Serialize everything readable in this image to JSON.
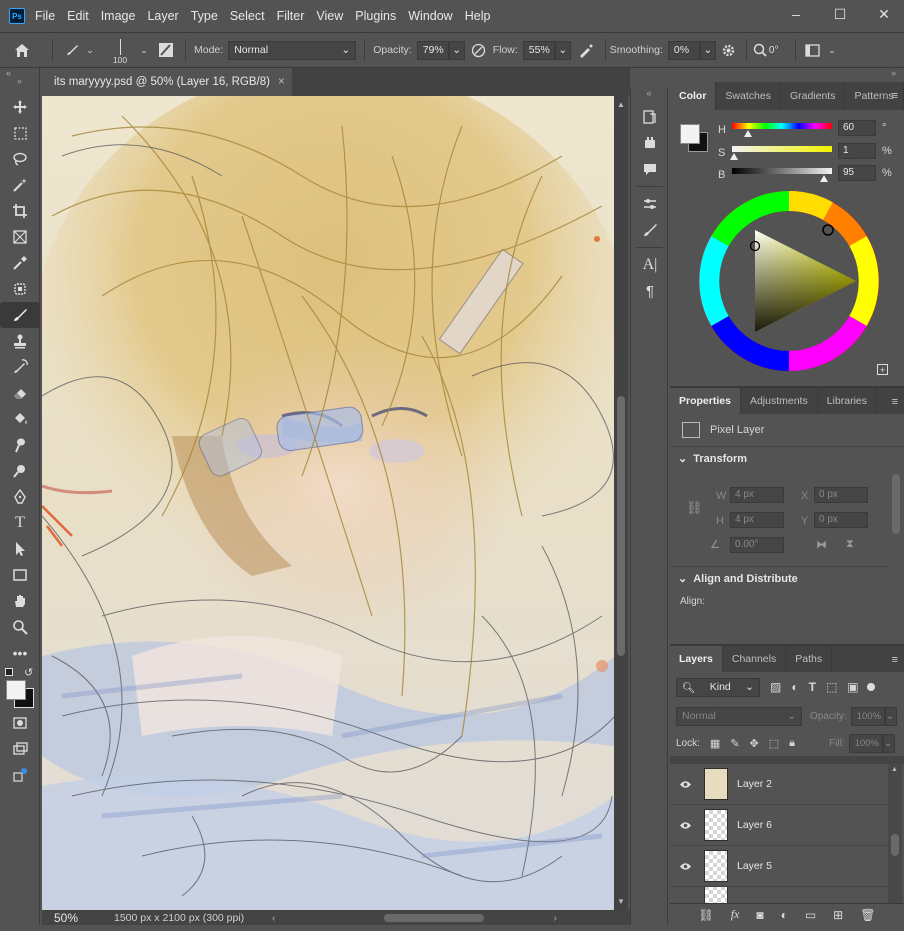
{
  "app": {
    "logo_text": "Ps"
  },
  "menu": [
    "File",
    "Edit",
    "Image",
    "Layer",
    "Type",
    "Select",
    "Filter",
    "View",
    "Plugins",
    "Window",
    "Help"
  ],
  "window_controls": {
    "minimize": "–",
    "maximize": "☐",
    "close": "✕"
  },
  "options": {
    "brush_size": "100",
    "mode_label": "Mode:",
    "mode_value": "Normal",
    "opacity_label": "Opacity:",
    "opacity_value": "79%",
    "flow_label": "Flow:",
    "flow_value": "55%",
    "smoothing_label": "Smoothing:",
    "smoothing_value": "0%",
    "angle_value": "0°"
  },
  "document": {
    "tab_title": "its maryyyy.psd @ 50% (Layer 16, RGB/8)",
    "tab_close": "×",
    "zoom": "50%",
    "dimensions": "1500 px x 2100 px (300 ppi)"
  },
  "color_panel": {
    "tabs": [
      "Color",
      "Swatches",
      "Gradients",
      "Patterns"
    ],
    "h_label": "H",
    "h_value": "60",
    "h_unit": "°",
    "s_label": "S",
    "s_value": "1",
    "s_unit": "%",
    "b_label": "B",
    "b_value": "95",
    "b_unit": "%"
  },
  "properties_panel": {
    "tabs": [
      "Properties",
      "Adjustments",
      "Libraries"
    ],
    "layer_type": "Pixel Layer",
    "transform_title": "Transform",
    "w_label": "W",
    "w_value": "4 px",
    "x_label": "X",
    "x_value": "0 px",
    "h_label": "H",
    "h_value": "4 px",
    "y_label": "Y",
    "y_value": "0 px",
    "angle_value": "0.00°",
    "align_title": "Align and Distribute",
    "align_label": "Align:"
  },
  "layers_panel": {
    "tabs": [
      "Layers",
      "Channels",
      "Paths"
    ],
    "filter_kind": "Kind",
    "blend_mode": "Normal",
    "opacity_label": "Opacity:",
    "opacity_value": "100%",
    "lock_label": "Lock:",
    "fill_label": "Fill:",
    "fill_value": "100%",
    "layers": [
      {
        "name": "Layer 2"
      },
      {
        "name": "Layer 6"
      },
      {
        "name": "Layer 5"
      },
      {
        "name": ""
      }
    ]
  },
  "colors": {
    "accent": "#31a8ff",
    "panel": "#535353",
    "dark": "#424242"
  }
}
